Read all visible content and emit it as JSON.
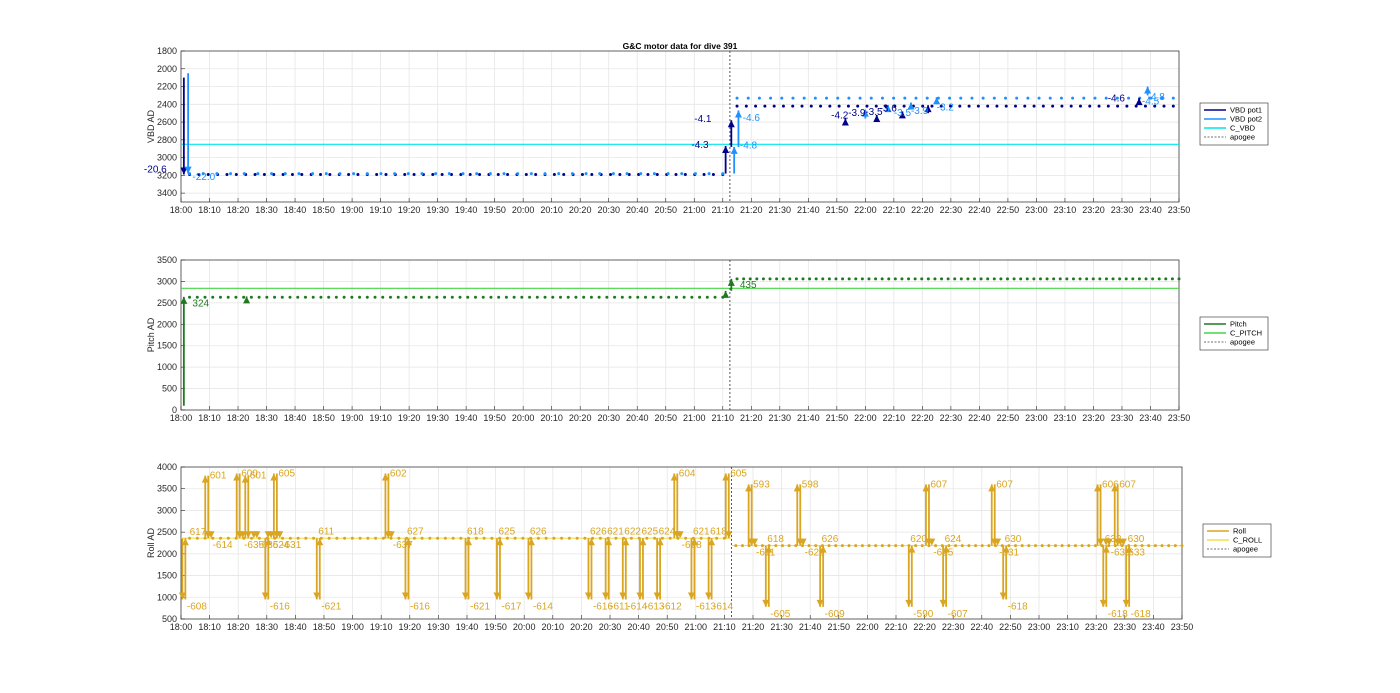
{
  "title": "G&C motor data for dive 391",
  "x_ticks": [
    "18:00",
    "18:10",
    "18:20",
    "18:30",
    "18:40",
    "18:50",
    "19:00",
    "19:10",
    "19:20",
    "19:30",
    "19:40",
    "19:50",
    "20:00",
    "20:10",
    "20:20",
    "20:30",
    "20:40",
    "20:50",
    "21:00",
    "21:10",
    "21:20",
    "21:30",
    "21:40",
    "21:50",
    "22:00",
    "22:10",
    "22:20",
    "22:30",
    "22:40",
    "22:50",
    "23:00",
    "23:10",
    "23:20",
    "23:30",
    "23:40",
    "23:50"
  ],
  "colors": {
    "vbd_pot1": "#00008b",
    "vbd_pot2": "#1e90ff",
    "c_vbd": "#00e5ee",
    "pitch": "#1f7a1f",
    "c_pitch": "#44d544",
    "roll": "#daa520",
    "c_roll": "#f0e050",
    "apogee": "#444444"
  },
  "chart_data": [
    {
      "type": "scatter",
      "ylabel": "VBD AD",
      "x_unit": "minutes after 18:00",
      "xlim": [
        0,
        350
      ],
      "ylim": [
        3500,
        1800
      ],
      "y_ticks": [
        1800,
        2000,
        2200,
        2400,
        2600,
        2800,
        3000,
        3200,
        3400
      ],
      "apogee_x": 192.5,
      "legend": [
        "VBD pot1",
        "VBD pot2",
        "C_VBD",
        "apogee"
      ],
      "series": [
        {
          "name": "VBD pot1",
          "x_start": 3,
          "x_end": 190,
          "y": 3190,
          "count": 58
        },
        {
          "name": "VBD pot1",
          "x_start": 195,
          "x_end": 348,
          "y": 2420,
          "count": 48
        },
        {
          "name": "VBD pot2",
          "x_start": 3,
          "x_end": 190,
          "y": 3180,
          "count": 40
        },
        {
          "name": "VBD pot2",
          "x_start": 195,
          "x_end": 348,
          "y": 2330,
          "count": 40
        }
      ],
      "c_lines": [
        {
          "name": "C_VBD",
          "y": 2850
        }
      ],
      "arrows": [
        {
          "x": 1,
          "y0": 2100,
          "y1": 3190,
          "c": "vbd_pot1"
        },
        {
          "x": 2.5,
          "y0": 2050,
          "y1": 3180,
          "c": "vbd_pot2"
        },
        {
          "x": 191,
          "y0": 3180,
          "y1": 2870,
          "c": "vbd_pot1"
        },
        {
          "x": 193,
          "y0": 2880,
          "y1": 2580,
          "c": "vbd_pot1"
        },
        {
          "x": 194,
          "y0": 3180,
          "y1": 2880,
          "c": "vbd_pot2"
        },
        {
          "x": 195.5,
          "y0": 2880,
          "y1": 2470,
          "c": "vbd_pot2"
        },
        {
          "x": 233,
          "y0": 2600,
          "y1": 2560,
          "c": "vbd_pot1"
        },
        {
          "x": 240,
          "y0": 2560,
          "y1": 2460,
          "c": "vbd_pot2"
        },
        {
          "x": 244,
          "y0": 2560,
          "y1": 2520,
          "c": "vbd_pot1"
        },
        {
          "x": 248,
          "y0": 2470,
          "y1": 2410,
          "c": "vbd_pot2"
        },
        {
          "x": 253,
          "y0": 2520,
          "y1": 2480,
          "c": "vbd_pot1"
        },
        {
          "x": 256,
          "y0": 2440,
          "y1": 2380,
          "c": "vbd_pot2"
        },
        {
          "x": 262,
          "y0": 2500,
          "y1": 2410,
          "c": "vbd_pot1"
        },
        {
          "x": 265,
          "y0": 2400,
          "y1": 2320,
          "c": "vbd_pot2"
        },
        {
          "x": 336,
          "y0": 2400,
          "y1": 2330,
          "c": "vbd_pot1"
        },
        {
          "x": 339,
          "y0": 2300,
          "y1": 2200,
          "c": "vbd_pot2"
        }
      ],
      "labels": [
        {
          "x": -13,
          "y": 3170,
          "t": "-20.6",
          "c": "vbd_pot1"
        },
        {
          "x": 4,
          "y": 3250,
          "t": "-22.0",
          "c": "vbd_pot2"
        },
        {
          "x": 180,
          "y": 2600,
          "t": "-4.1",
          "c": "vbd_pot1"
        },
        {
          "x": 179,
          "y": 2890,
          "t": "-4.3",
          "c": "vbd_pot1"
        },
        {
          "x": 197,
          "y": 2590,
          "t": "-4.6",
          "c": "vbd_pot2"
        },
        {
          "x": 196,
          "y": 2900,
          "t": "-4.8",
          "c": "vbd_pot2"
        },
        {
          "x": 228,
          "y": 2560,
          "t": "-4.2",
          "c": "vbd_pot1"
        },
        {
          "x": 234,
          "y": 2530,
          "t": "-3.9",
          "c": "vbd_pot1"
        },
        {
          "x": 240,
          "y": 2520,
          "t": "-3.5",
          "c": "vbd_pot1"
        },
        {
          "x": 245,
          "y": 2480,
          "t": "-3.6",
          "c": "vbd_pot1"
        },
        {
          "x": 250,
          "y": 2530,
          "t": "-3.5",
          "c": "vbd_pot2"
        },
        {
          "x": 256,
          "y": 2510,
          "t": "-3.9",
          "c": "vbd_pot2"
        },
        {
          "x": 265,
          "y": 2470,
          "t": "-3.2",
          "c": "vbd_pot2"
        },
        {
          "x": 325,
          "y": 2370,
          "t": "-4.6",
          "c": "vbd_pot1"
        },
        {
          "x": 339,
          "y": 2350,
          "t": "-4.8",
          "c": "vbd_pot2"
        },
        {
          "x": 337,
          "y": 2400,
          "t": "-4.5",
          "c": "vbd_pot2"
        }
      ]
    },
    {
      "type": "scatter",
      "ylabel": "Pitch AD",
      "x_unit": "minutes after 18:00",
      "xlim": [
        0,
        350
      ],
      "ylim": [
        0,
        3500
      ],
      "y_ticks": [
        0,
        500,
        1000,
        1500,
        2000,
        2500,
        3000,
        3500
      ],
      "apogee_x": 192.5,
      "legend": [
        "Pitch",
        "C_PITCH",
        "apogee"
      ],
      "series": [
        {
          "name": "Pitch",
          "x_start": 3,
          "x_end": 190,
          "y": 2630,
          "count": 70
        },
        {
          "name": "Pitch",
          "x_start": 195,
          "x_end": 350,
          "y": 3060,
          "count": 68
        }
      ],
      "c_lines": [
        {
          "name": "C_PITCH",
          "y": 2840
        }
      ],
      "arrows": [
        {
          "x": 1,
          "y0": 100,
          "y1": 2640,
          "c": "pitch"
        },
        {
          "x": 23,
          "y0": 2620,
          "y1": 2650,
          "c": "pitch"
        },
        {
          "x": 191,
          "y0": 2630,
          "y1": 2780,
          "c": "pitch"
        },
        {
          "x": 193,
          "y0": 2780,
          "y1": 3060,
          "c": "pitch"
        }
      ],
      "labels": [
        {
          "x": 4,
          "y": 2420,
          "t": "324",
          "c": "pitch"
        },
        {
          "x": 196,
          "y": 2850,
          "t": "435",
          "c": "pitch"
        }
      ]
    },
    {
      "type": "scatter",
      "ylabel": "Roll AD",
      "x_unit": "minutes after 18:00",
      "xlim": [
        0,
        350
      ],
      "ylim": [
        500,
        4000
      ],
      "y_ticks": [
        500,
        1000,
        1500,
        2000,
        2500,
        3000,
        3500,
        4000
      ],
      "apogee_x": 192.5,
      "legend": [
        "Roll",
        "C_ROLL",
        "apogee"
      ],
      "series": [
        {
          "name": "Roll",
          "x_start": 3,
          "x_end": 190,
          "y": 2360,
          "count": 70
        },
        {
          "name": "Roll",
          "x_start": 194,
          "x_end": 350,
          "y": 2190,
          "count": 68
        }
      ],
      "c_lines": [
        {
          "name": "C_ROLL",
          "y": 2360,
          "x0": 0,
          "x1": 192.5
        },
        {
          "name": "C_ROLL",
          "y": 2190,
          "x0": 192.5,
          "x1": 350
        }
      ],
      "swings": [
        {
          "x": 1,
          "y": 950,
          "t": "-608"
        },
        {
          "x": 9,
          "y": 3800,
          "t": "601"
        },
        {
          "x": 10,
          "y": 2360,
          "t": "-614"
        },
        {
          "x": 20,
          "y": 3850,
          "t": "600"
        },
        {
          "x": 21,
          "y": 2360,
          "t": "-635"
        },
        {
          "x": 23,
          "y": 3800,
          "t": "601"
        },
        {
          "x": 26,
          "y": 2360,
          "t": "-635"
        },
        {
          "x": 30,
          "y": 950,
          "t": "-616"
        },
        {
          "x": 31,
          "y": 2360,
          "t": "624"
        },
        {
          "x": 33,
          "y": 3850,
          "t": "605"
        },
        {
          "x": 34,
          "y": 2360,
          "t": "-631"
        },
        {
          "x": 48,
          "y": 950,
          "t": "-621"
        },
        {
          "x": 72,
          "y": 3850,
          "t": "602"
        },
        {
          "x": 73,
          "y": 2360,
          "t": "-637"
        },
        {
          "x": 79,
          "y": 950,
          "t": "-616"
        },
        {
          "x": 100,
          "y": 950,
          "t": "-621"
        },
        {
          "x": 111,
          "y": 950,
          "t": "-617"
        },
        {
          "x": 122,
          "y": 950,
          "t": "-614"
        },
        {
          "x": 143,
          "y": 950,
          "t": "-616"
        },
        {
          "x": 149,
          "y": 950,
          "t": "-611"
        },
        {
          "x": 155,
          "y": 950,
          "t": "-614"
        },
        {
          "x": 161,
          "y": 950,
          "t": "-613"
        },
        {
          "x": 167,
          "y": 950,
          "t": "-612"
        },
        {
          "x": 173,
          "y": 3850,
          "t": "604"
        },
        {
          "x": 174,
          "y": 2360,
          "t": "-628"
        },
        {
          "x": 179,
          "y": 950,
          "t": "-613"
        },
        {
          "x": 185,
          "y": 950,
          "t": "-614"
        },
        {
          "x": 191,
          "y": 3850,
          "t": "605"
        },
        {
          "x": 199,
          "y": 3600,
          "t": "593"
        },
        {
          "x": 200,
          "y": 2190,
          "t": "-611"
        },
        {
          "x": 205,
          "y": 780,
          "t": "-605"
        },
        {
          "x": 216,
          "y": 3600,
          "t": "598"
        },
        {
          "x": 217,
          "y": 2190,
          "t": "-622"
        },
        {
          "x": 224,
          "y": 780,
          "t": "-609"
        },
        {
          "x": 255,
          "y": 780,
          "t": "-590"
        },
        {
          "x": 261,
          "y": 3600,
          "t": "607"
        },
        {
          "x": 262,
          "y": 2190,
          "t": "-625"
        },
        {
          "x": 267,
          "y": 780,
          "t": "-607"
        },
        {
          "x": 284,
          "y": 3600,
          "t": "607"
        },
        {
          "x": 285,
          "y": 2190,
          "t": "-631"
        },
        {
          "x": 288,
          "y": 950,
          "t": "-618"
        },
        {
          "x": 321,
          "y": 3600,
          "t": "606"
        },
        {
          "x": 323,
          "y": 780,
          "t": "-618"
        },
        {
          "x": 324,
          "y": 2190,
          "t": "-633"
        },
        {
          "x": 327,
          "y": 3600,
          "t": "607"
        },
        {
          "x": 329,
          "y": 2190,
          "t": "-633"
        },
        {
          "x": 331,
          "y": 780,
          "t": "-618"
        }
      ],
      "labels": [
        {
          "x": 3,
          "y": 2430,
          "t": "617"
        },
        {
          "x": 48,
          "y": 2450,
          "t": "611"
        },
        {
          "x": 79,
          "y": 2450,
          "t": "627"
        },
        {
          "x": 100,
          "y": 2450,
          "t": "618"
        },
        {
          "x": 111,
          "y": 2450,
          "t": "625"
        },
        {
          "x": 122,
          "y": 2450,
          "t": "626"
        },
        {
          "x": 143,
          "y": 2450,
          "t": "626"
        },
        {
          "x": 149,
          "y": 2450,
          "t": "621"
        },
        {
          "x": 155,
          "y": 2450,
          "t": "622"
        },
        {
          "x": 161,
          "y": 2450,
          "t": "625"
        },
        {
          "x": 167,
          "y": 2450,
          "t": "624"
        },
        {
          "x": 179,
          "y": 2450,
          "t": "621"
        },
        {
          "x": 185,
          "y": 2450,
          "t": "618"
        },
        {
          "x": 205,
          "y": 2270,
          "t": "618"
        },
        {
          "x": 224,
          "y": 2270,
          "t": "626"
        },
        {
          "x": 255,
          "y": 2270,
          "t": "620"
        },
        {
          "x": 267,
          "y": 2270,
          "t": "624"
        },
        {
          "x": 288,
          "y": 2270,
          "t": "630"
        },
        {
          "x": 331,
          "y": 2270,
          "t": "630"
        },
        {
          "x": 323,
          "y": 2270,
          "t": "632"
        }
      ]
    }
  ]
}
